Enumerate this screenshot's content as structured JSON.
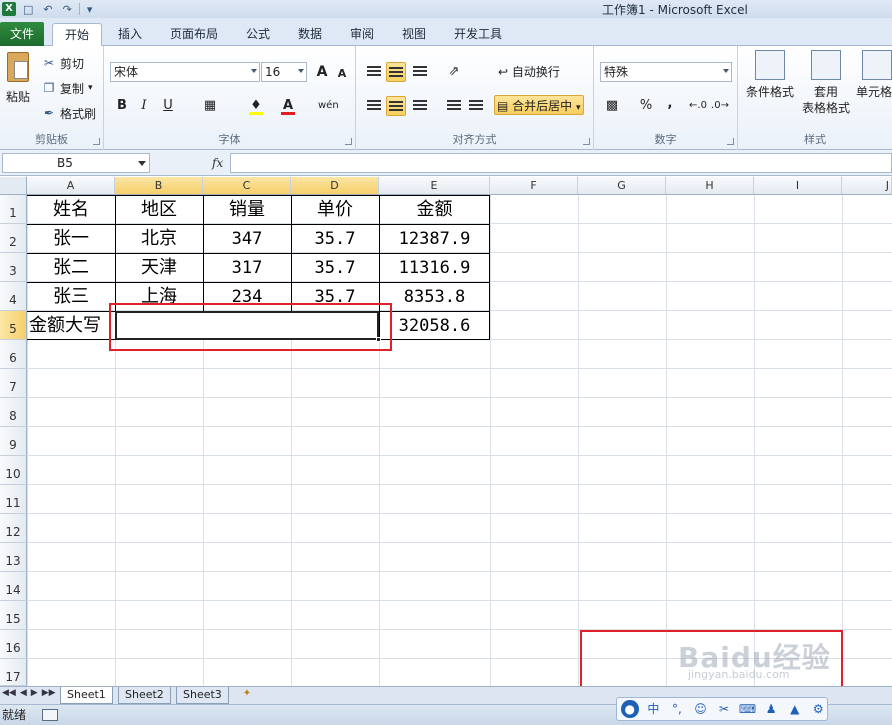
{
  "window": {
    "title": "工作簿1  -  Microsoft Excel"
  },
  "quick_access": {
    "items": [
      "save-icon",
      "undo-icon",
      "redo-icon"
    ]
  },
  "tabs": [
    {
      "label": "文件",
      "active": false
    },
    {
      "label": "开始",
      "active": true
    },
    {
      "label": "插入",
      "active": false
    },
    {
      "label": "页面布局",
      "active": false
    },
    {
      "label": "公式",
      "active": false
    },
    {
      "label": "数据",
      "active": false
    },
    {
      "label": "审阅",
      "active": false
    },
    {
      "label": "视图",
      "active": false
    },
    {
      "label": "开发工具",
      "active": false
    }
  ],
  "ribbon": {
    "clipboard": {
      "label": "剪贴板",
      "paste": "粘贴",
      "cut": "剪切",
      "copy": "复制",
      "format_painter": "格式刷"
    },
    "font": {
      "label": "字体",
      "name": "宋体",
      "size": "16",
      "bold": "B",
      "italic": "I",
      "underline": "U",
      "grow": "A",
      "shrink": "A",
      "phonetic": "wén"
    },
    "alignment": {
      "label": "对齐方式",
      "wrap_text": "自动换行",
      "merge_center": "合并后居中"
    },
    "number": {
      "label": "数字",
      "format": "特殊",
      "percent": "%",
      "comma": ","
    },
    "styles": {
      "label": "样式",
      "conditional": "条件格式",
      "table_format_1": "套用",
      "table_format_2": "表格格式",
      "cell_styles": "单元格"
    }
  },
  "formula_bar": {
    "name_box": "B5",
    "fx": "fx",
    "content": ""
  },
  "columns": [
    "A",
    "B",
    "C",
    "D",
    "E",
    "F",
    "G",
    "H",
    "I",
    "J"
  ],
  "selected_columns": [
    "B",
    "C",
    "D"
  ],
  "rows": [
    "1",
    "2",
    "3",
    "4",
    "5",
    "6",
    "7",
    "8",
    "9",
    "10",
    "11",
    "12",
    "13",
    "14",
    "15",
    "16",
    "17"
  ],
  "selected_row": "5",
  "table": {
    "header": [
      "姓名",
      "地区",
      "销量",
      "单价",
      "金额"
    ],
    "rows": [
      [
        "张一",
        "北京",
        "347",
        "35.7",
        "12387.9"
      ],
      [
        "张二",
        "天津",
        "317",
        "35.7",
        "11316.9"
      ],
      [
        "张三",
        "上海",
        "234",
        "35.7",
        "8353.8"
      ]
    ],
    "total_label": "金额大写",
    "total_value": "32058.6"
  },
  "sheets": [
    {
      "label": "Sheet1",
      "active": true
    },
    {
      "label": "Sheet2",
      "active": false
    },
    {
      "label": "Sheet3",
      "active": false
    }
  ],
  "status": {
    "text": "就绪"
  },
  "ime": {
    "lang": "中",
    "icons": [
      "user-icon",
      "lang-zh-icon",
      "punct-icon",
      "emoji-icon",
      "scissors-icon",
      "keyboard-icon",
      "person-icon",
      "shirt-icon",
      "gear-icon"
    ]
  },
  "watermark": {
    "main": "Baidu经验",
    "sub": "jingyan.baidu.com"
  },
  "colors": {
    "accent_green": "#1e7a3c",
    "highlight_red": "#e0212b",
    "selected_header": "#f6cf6a"
  }
}
